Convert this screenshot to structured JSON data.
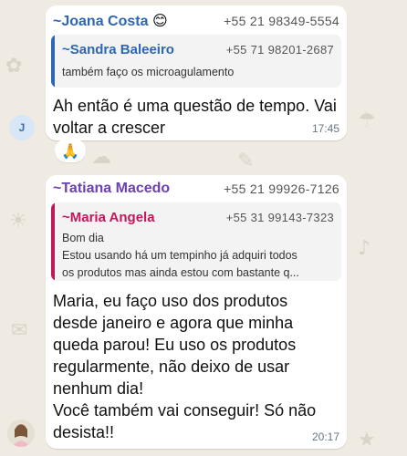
{
  "message1": {
    "sender_name": "~Joana Costa",
    "sender_emoji": "😊",
    "sender_phone": "+55 21 98349-5554",
    "sender_color": "#2e66b4",
    "quote": {
      "name": "~Sandra Baleeiro",
      "phone": "+55 71 98201-2687",
      "text": "também faço os microagulamento",
      "color": "#2e66b4"
    },
    "text_lines": [
      "Ah então é uma questão de tempo. Vai",
      "voltar a crescer"
    ],
    "time": "17:45",
    "avatar_initial": "J",
    "reaction": "🙏"
  },
  "message2": {
    "sender_name": "~Tatiana Macedo",
    "sender_phone": "+55 21 99926-7126",
    "sender_color": "#6b3fb5",
    "quote": {
      "name": "~Maria Angela",
      "phone": "+55 31 99143-7323",
      "line1": "Bom dia",
      "line2": "Estou usando há um tempinho já adquiri todos",
      "line3": "os produtos mas ainda estou com bastante q...",
      "color": "#c2185b"
    },
    "text_lines": [
      "Maria, eu faço uso dos produtos",
      "desde janeiro e agora que minha",
      "queda parou! Eu uso os produtos",
      "regularmente, não deixo de usar",
      "nenhum dia!",
      "Você também vai conseguir! Só não",
      "desista!!"
    ],
    "time": "20:17"
  }
}
